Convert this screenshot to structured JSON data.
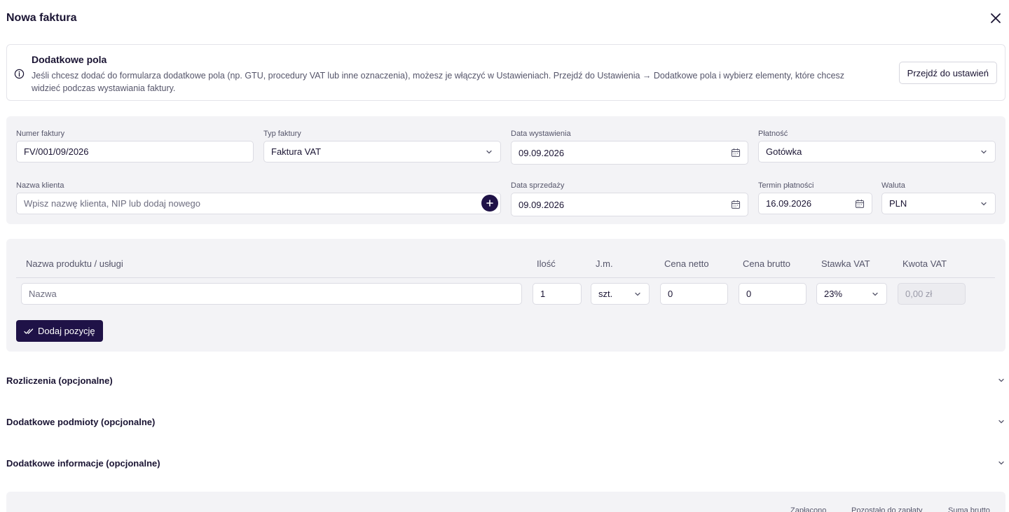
{
  "header": {
    "title": "Nowa faktura"
  },
  "info": {
    "title": "Dodatkowe pola",
    "text": "Jeśli chcesz dodać do formularza dodatkowe pola (np. GTU, procedury VAT lub inne oznaczenia), możesz je włączyć w Ustawieniach. Przejdź do Ustawienia → Dodatkowe pola i wybierz elementy, które chcesz widzieć podczas wystawiania faktury.",
    "button_label": "Przejdź do ustawień"
  },
  "form": {
    "invoice_number": {
      "label": "Numer faktury",
      "value": "FV/001/09/2026"
    },
    "invoice_type": {
      "label": "Typ faktury",
      "value": "Faktura VAT"
    },
    "issue_date": {
      "label": "Data wystawienia",
      "value": "09.09.2026"
    },
    "payment": {
      "label": "Płatność",
      "value": "Gotówka"
    },
    "client_name": {
      "label": "Nazwa klienta",
      "placeholder": "Wpisz nazwę klienta, NIP lub dodaj nowego"
    },
    "sale_date": {
      "label": "Data sprzedaży",
      "value": "09.09.2026"
    },
    "payment_due": {
      "label": "Termin płatności",
      "value": "16.09.2026"
    },
    "currency": {
      "label": "Waluta",
      "value": "PLN"
    }
  },
  "items": {
    "columns": [
      "Nazwa produktu / usługi",
      "Ilość",
      "J.m.",
      "Cena netto",
      "Cena brutto",
      "Stawka VAT",
      "Kwota VAT"
    ],
    "row": {
      "name_placeholder": "Nazwa",
      "quantity": "1",
      "unit": "szt.",
      "net_price": "0",
      "gross_price": "0",
      "vat_rate": "23%",
      "vat_amount": "0,00 zł"
    },
    "add_label": "Dodaj pozycję"
  },
  "sections": [
    {
      "label": "Rozliczenia (opcjonalne)"
    },
    {
      "label": "Dodatkowe podmioty (opcjonalne)"
    },
    {
      "label": "Dodatkowe informacje (opcjonalne)"
    }
  ],
  "summary": {
    "paid_label": "Zapłacono",
    "remaining_label": "Pozostało do zapłaty",
    "gross_total_label": "Suma brutto"
  },
  "colors": {
    "primary": "#1f1247",
    "panel": "#f3f3f6",
    "border": "#dcdce3"
  },
  "icons": {
    "close": "close-icon",
    "info": "info-icon",
    "calendar": "calendar-icon",
    "chevron": "chevron-down-icon",
    "plus": "plus-icon",
    "check": "double-check-icon"
  }
}
